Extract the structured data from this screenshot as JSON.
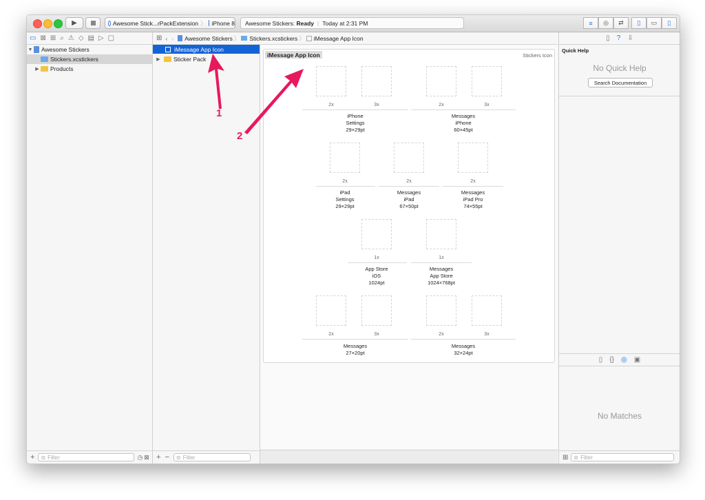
{
  "toolbar": {
    "scheme_target": "Awesome Stick...rPackExtension",
    "device": "iPhone 8",
    "status_app": "Awesome Stickers:",
    "status_state": "Ready",
    "status_time": "Today at 2:31 PM"
  },
  "navigator": {
    "items": [
      {
        "label": "Awesome Stickers"
      },
      {
        "label": "Stickers.xcstickers"
      },
      {
        "label": "Products"
      }
    ],
    "filter_placeholder": "Filter"
  },
  "asset_list": {
    "items": [
      {
        "label": "iMessage App Icon"
      },
      {
        "label": "Sticker Pack"
      }
    ],
    "filter_placeholder": "Filter"
  },
  "jumpbar": {
    "crumbs": [
      "Awesome Stickers",
      "Stickers.xcstickers",
      "iMessage App Icon"
    ]
  },
  "editor": {
    "title": "iMessage App Icon",
    "type_label": "Stickers Icon",
    "scales": {
      "s2x": "2x",
      "s3x": "3x",
      "s1x": "1x"
    },
    "groups": [
      {
        "caption": "iPhone\nSettings\n29×29pt"
      },
      {
        "caption": "Messages\niPhone\n60×45pt"
      },
      {
        "caption": "iPad\nSettings\n29×29pt"
      },
      {
        "caption": "Messages\niPad\n67×50pt"
      },
      {
        "caption": "Messages\niPad Pro\n74×55pt"
      },
      {
        "caption": "App Store\niOS\n1024pt"
      },
      {
        "caption": "Messages\nApp Store\n1024×768pt"
      },
      {
        "caption": "Messages\n27×20pt"
      },
      {
        "caption": "Messages\n32×24pt"
      }
    ]
  },
  "inspector": {
    "header": "Quick Help",
    "no_help": "No Quick Help",
    "search_button": "Search Documentation",
    "no_matches": "No Matches",
    "filter_placeholder": "Filter"
  },
  "annotations": {
    "first": "1",
    "second": "2"
  },
  "colors": {
    "accent": "#1463d6",
    "annotation": "#e8185c"
  }
}
